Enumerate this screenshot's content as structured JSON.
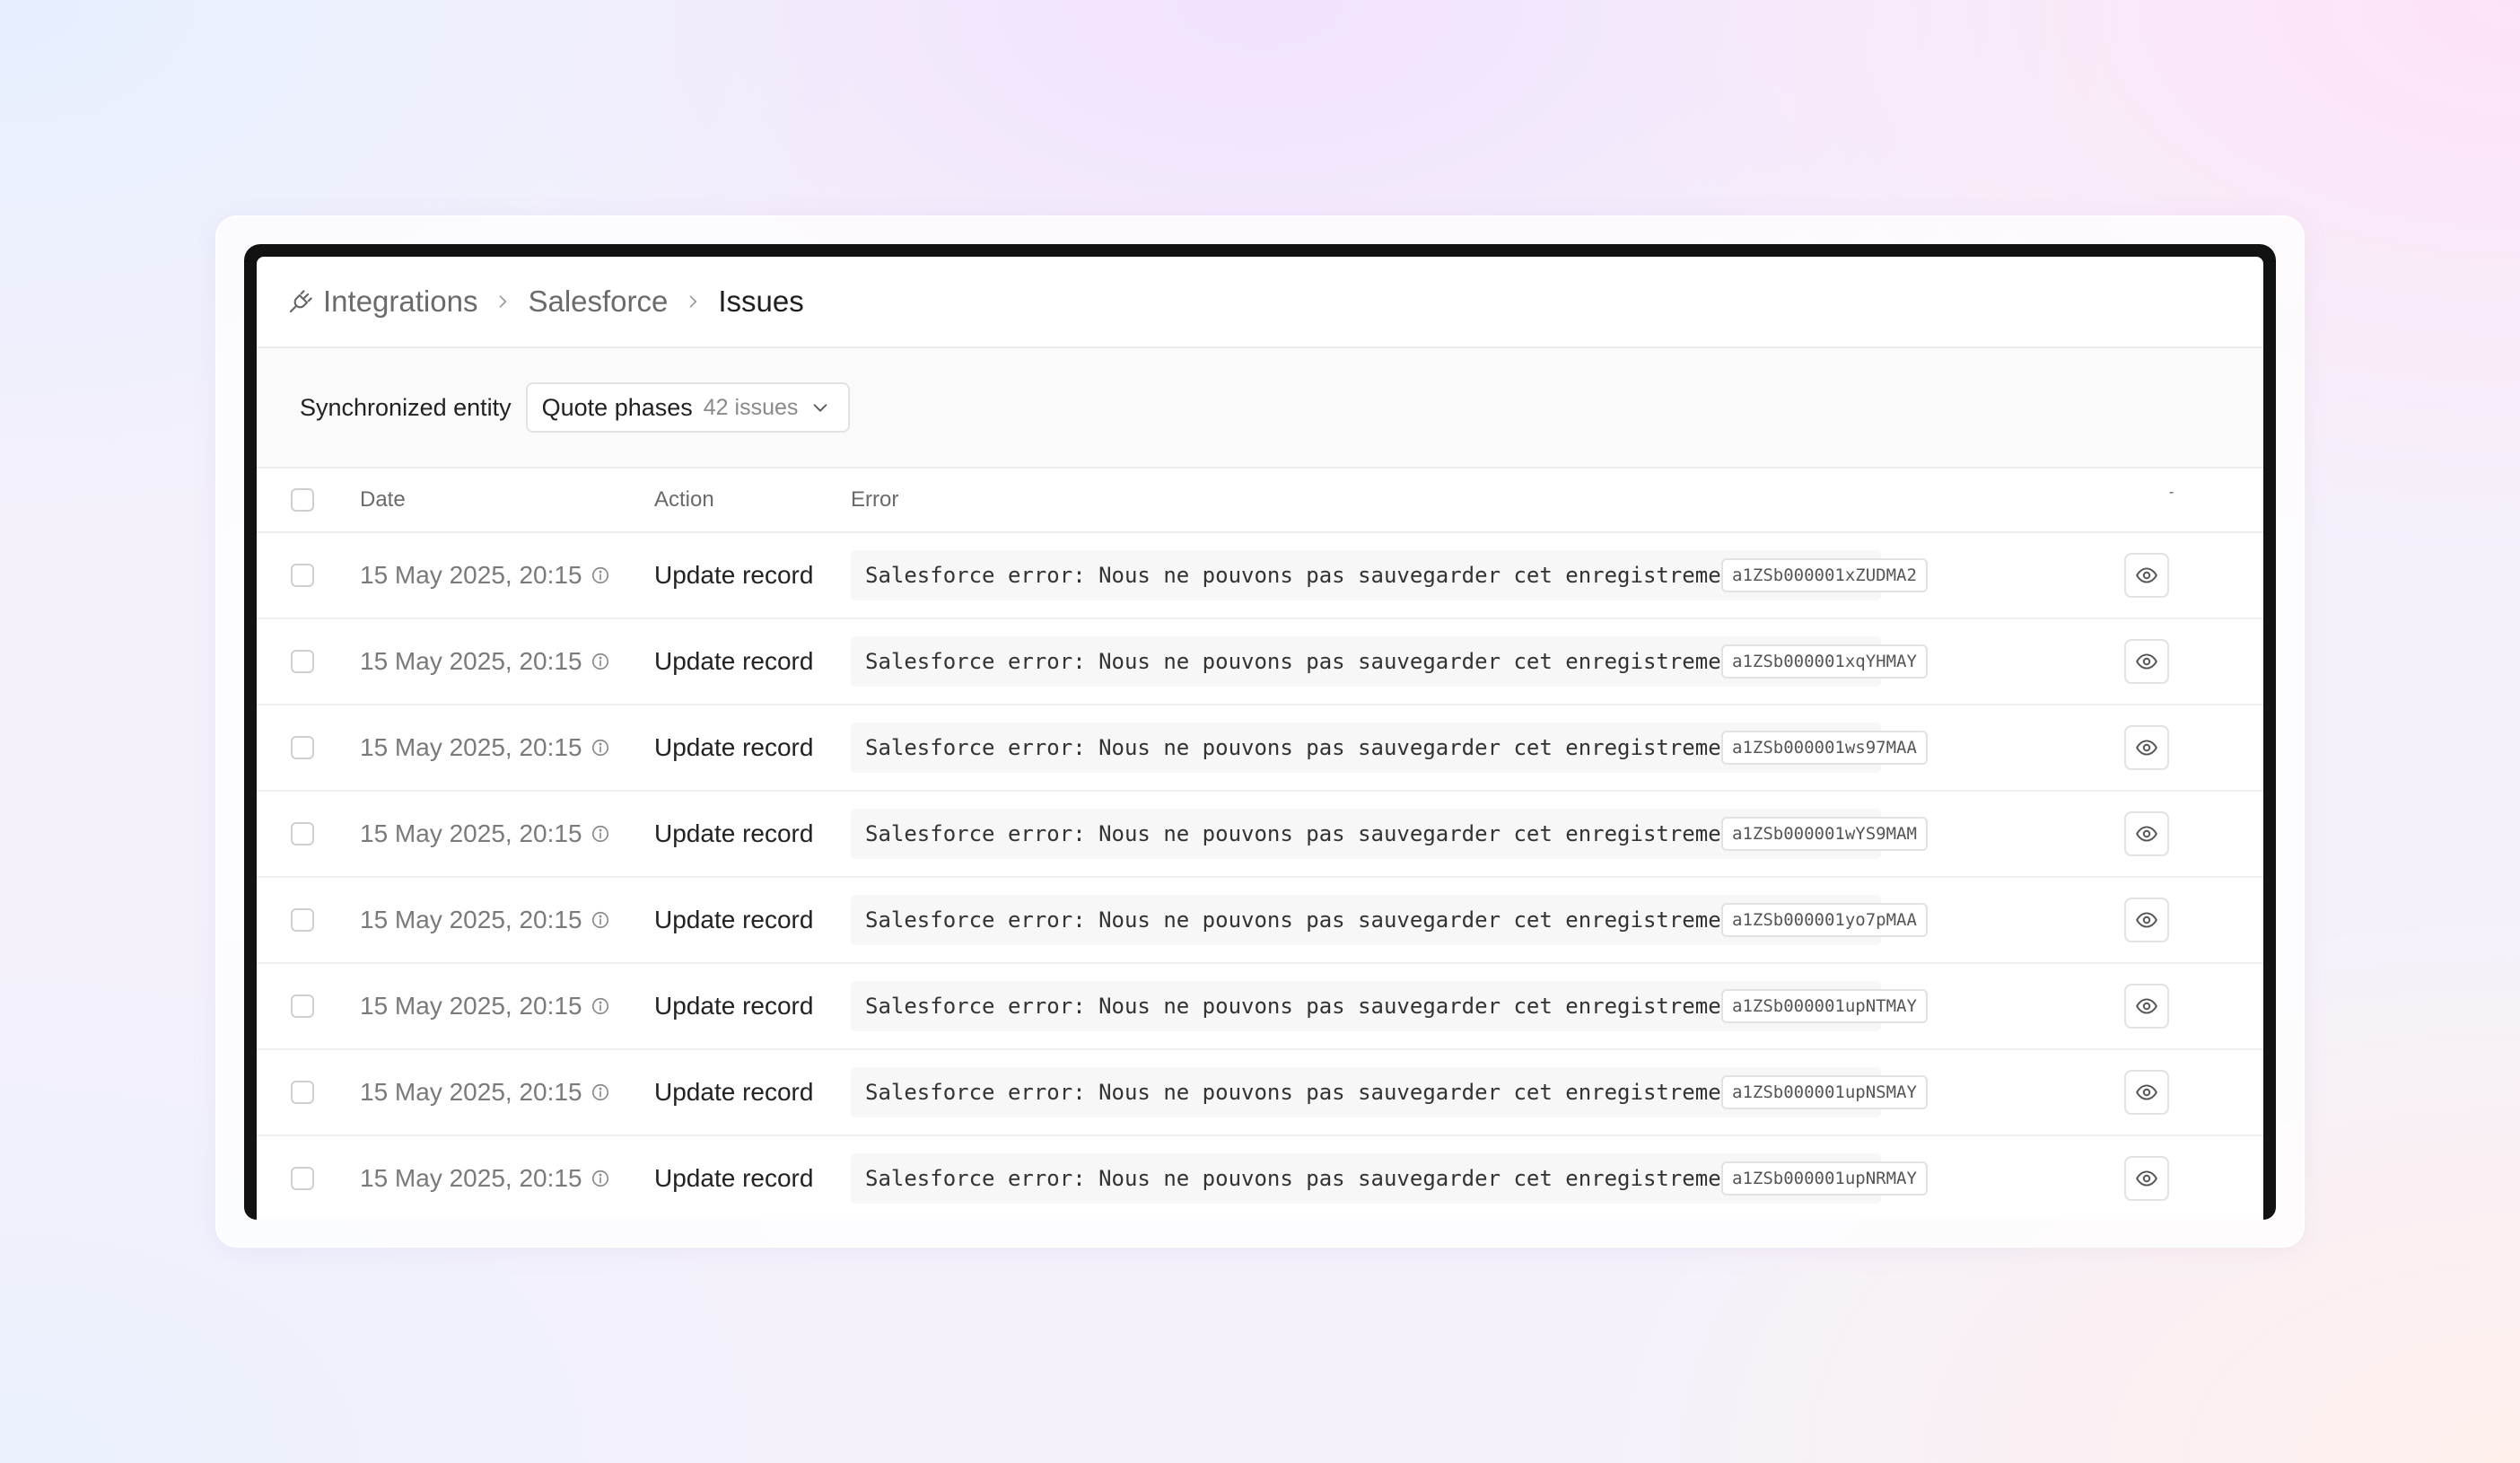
{
  "breadcrumb": {
    "items": [
      {
        "label": "Integrations"
      },
      {
        "label": "Salesforce"
      },
      {
        "label": "Issues"
      }
    ]
  },
  "filter": {
    "label": "Synchronized entity",
    "entity": "Quote phases",
    "count": "42 issues"
  },
  "table": {
    "columns": {
      "date": "Date",
      "action": "Action",
      "error": "Error",
      "extra": "-"
    },
    "rows": [
      {
        "date": "15 May 2025, 20:15",
        "action": "Update record",
        "error": "Salesforce error: Nous ne pouvons pas sauvegarder cet enregistrement, car le p…",
        "id": "a1ZSb000001xZUDMA2"
      },
      {
        "date": "15 May 2025, 20:15",
        "action": "Update record",
        "error": "Salesforce error: Nous ne pouvons pas sauvegarder cet enregistrement, car le p…",
        "id": "a1ZSb000001xqYHMAY"
      },
      {
        "date": "15 May 2025, 20:15",
        "action": "Update record",
        "error": "Salesforce error: Nous ne pouvons pas sauvegarder cet enregistrement, car le p…",
        "id": "a1ZSb000001ws97MAA"
      },
      {
        "date": "15 May 2025, 20:15",
        "action": "Update record",
        "error": "Salesforce error: Nous ne pouvons pas sauvegarder cet enregistrement, car le p…",
        "id": "a1ZSb000001wYS9MAM"
      },
      {
        "date": "15 May 2025, 20:15",
        "action": "Update record",
        "error": "Salesforce error: Nous ne pouvons pas sauvegarder cet enregistrement, car le p…",
        "id": "a1ZSb000001yo7pMAA"
      },
      {
        "date": "15 May 2025, 20:15",
        "action": "Update record",
        "error": "Salesforce error: Nous ne pouvons pas sauvegarder cet enregistrement, car le p…",
        "id": "a1ZSb000001upNTMAY"
      },
      {
        "date": "15 May 2025, 20:15",
        "action": "Update record",
        "error": "Salesforce error: Nous ne pouvons pas sauvegarder cet enregistrement, car le p…",
        "id": "a1ZSb000001upNSMAY"
      },
      {
        "date": "15 May 2025, 20:15",
        "action": "Update record",
        "error": "Salesforce error: Nous ne pouvons pas sauvegarder cet enregistrement, car le p…",
        "id": "a1ZSb000001upNRMAY"
      }
    ]
  },
  "icons": {
    "breadcrumb_root": "plug-icon",
    "separator": "chevron-right-icon",
    "select": "chevron-down-icon",
    "date_info": "info-icon",
    "view": "eye-icon"
  },
  "colors": {
    "text_primary": "#1f1f1f",
    "text_muted": "#7a7a7a",
    "border": "#e2e2e2",
    "frame": "#121212"
  }
}
